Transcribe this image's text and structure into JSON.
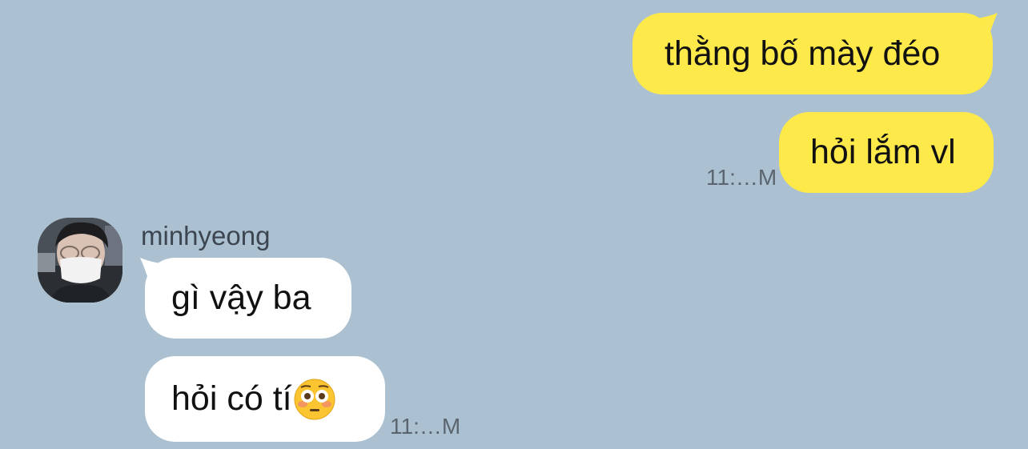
{
  "colors": {
    "background": "#abc1d1",
    "outgoing_bubble": "#fee94a",
    "incoming_bubble": "#ffffff",
    "timestamp": "#5b6570",
    "sender_name": "#3d4650"
  },
  "outgoing": {
    "messages": [
      {
        "text": "thằng bố mày đéo"
      },
      {
        "text": "hỏi lắm vl"
      }
    ],
    "timestamp": "11:…M"
  },
  "incoming": {
    "sender": "minhyeong",
    "avatar_icon": "avatar-photo",
    "messages": [
      {
        "text": "gì vậy ba"
      },
      {
        "text": "hỏi có tí",
        "emoji": "flushed-face-emoji"
      }
    ],
    "timestamp": "11:…M"
  }
}
